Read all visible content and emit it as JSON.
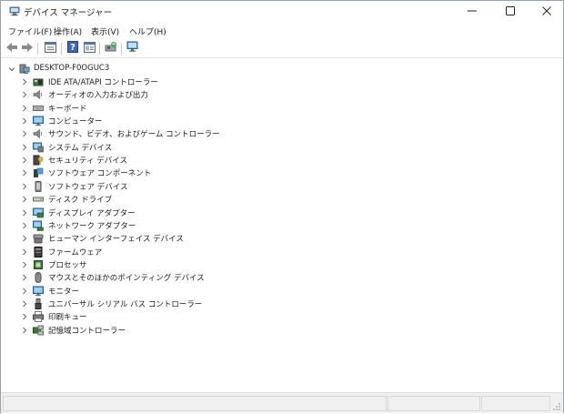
{
  "window": {
    "title": "デバイス マネージャー",
    "minimize_icon": "minimize-icon",
    "maximize_icon": "maximize-icon",
    "close_icon": "close-icon"
  },
  "menu": [
    {
      "label": "ファイル(F)"
    },
    {
      "label": "操作(A)"
    },
    {
      "label": "表示(V)"
    },
    {
      "label": "ヘルプ(H)"
    }
  ],
  "toolbar": [
    {
      "icon": "back-arrow-icon"
    },
    {
      "icon": "forward-arrow-icon"
    },
    {
      "icon": "properties-icon"
    },
    {
      "icon": "help-icon"
    },
    {
      "icon": "console-tree-icon"
    },
    {
      "icon": "update-driver-icon"
    },
    {
      "icon": "scan-hardware-icon"
    }
  ],
  "tree": {
    "root_label": "DESKTOP-F0OGUC3",
    "categories": [
      {
        "label": "IDE ATA/ATAPI コントローラー",
        "icon": "ide-controller-icon"
      },
      {
        "label": "オーディオの入力および出力",
        "icon": "speaker-icon"
      },
      {
        "label": "キーボード",
        "icon": "keyboard-icon"
      },
      {
        "label": "コンピューター",
        "icon": "computer-icon"
      },
      {
        "label": "サウンド、ビデオ、およびゲーム コントローラー",
        "icon": "speaker-icon"
      },
      {
        "label": "システム デバイス",
        "icon": "system-device-icon"
      },
      {
        "label": "セキュリティ デバイス",
        "icon": "security-key-icon"
      },
      {
        "label": "ソフトウェア コンポーネント",
        "icon": "software-component-icon"
      },
      {
        "label": "ソフトウェア デバイス",
        "icon": "software-device-icon"
      },
      {
        "label": "ディスク ドライブ",
        "icon": "disk-drive-icon"
      },
      {
        "label": "ディスプレイ アダプター",
        "icon": "display-adapter-icon"
      },
      {
        "label": "ネットワーク アダプター",
        "icon": "network-adapter-icon"
      },
      {
        "label": "ヒューマン インターフェイス デバイス",
        "icon": "hid-icon"
      },
      {
        "label": "ファームウェア",
        "icon": "firmware-icon"
      },
      {
        "label": "プロセッサ",
        "icon": "processor-icon"
      },
      {
        "label": "マウスとそのほかのポインティング デバイス",
        "icon": "mouse-icon"
      },
      {
        "label": "モニター",
        "icon": "monitor-icon"
      },
      {
        "label": "ユニバーサル シリアル バス コントローラー",
        "icon": "usb-icon"
      },
      {
        "label": "印刷キュー",
        "icon": "printer-icon"
      },
      {
        "label": "記憶域コントローラー",
        "icon": "storage-controller-icon"
      }
    ]
  }
}
